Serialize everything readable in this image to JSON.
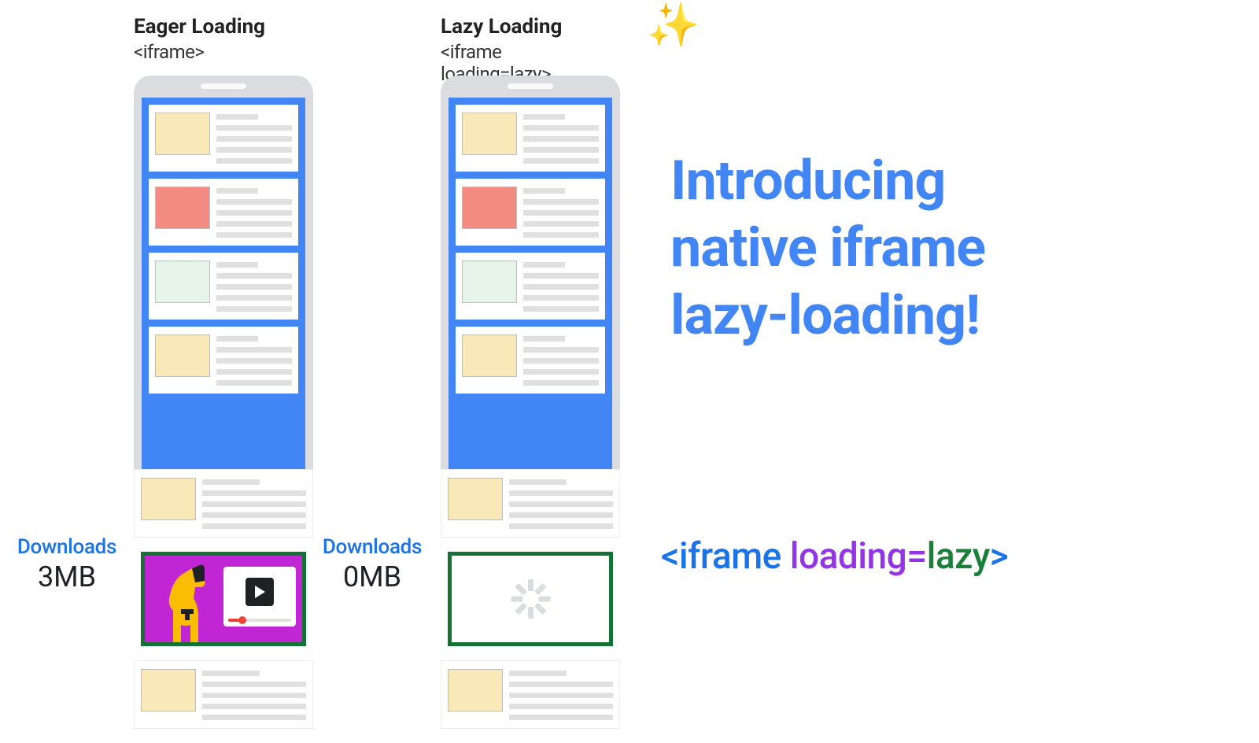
{
  "columns": {
    "eager": {
      "title": "Eager Loading",
      "subtitle": "<iframe>",
      "download_label": "Downloads",
      "download_size": "3MB"
    },
    "lazy": {
      "title": "Lazy Loading",
      "subtitle": "<iframe loading=lazy>",
      "download_label": "Downloads",
      "download_size": "0MB"
    }
  },
  "headline": {
    "line1": "Introducing",
    "line2": "native iframe",
    "line3": "lazy-loading!"
  },
  "code": {
    "open": "<iframe",
    "attr": "loading",
    "eq": "=",
    "val": "lazy",
    "close": ">"
  },
  "icons": {
    "sparkles": "✨",
    "iframe_content": "dog-and-video-icon",
    "iframe_placeholder": "spinner-icon"
  }
}
